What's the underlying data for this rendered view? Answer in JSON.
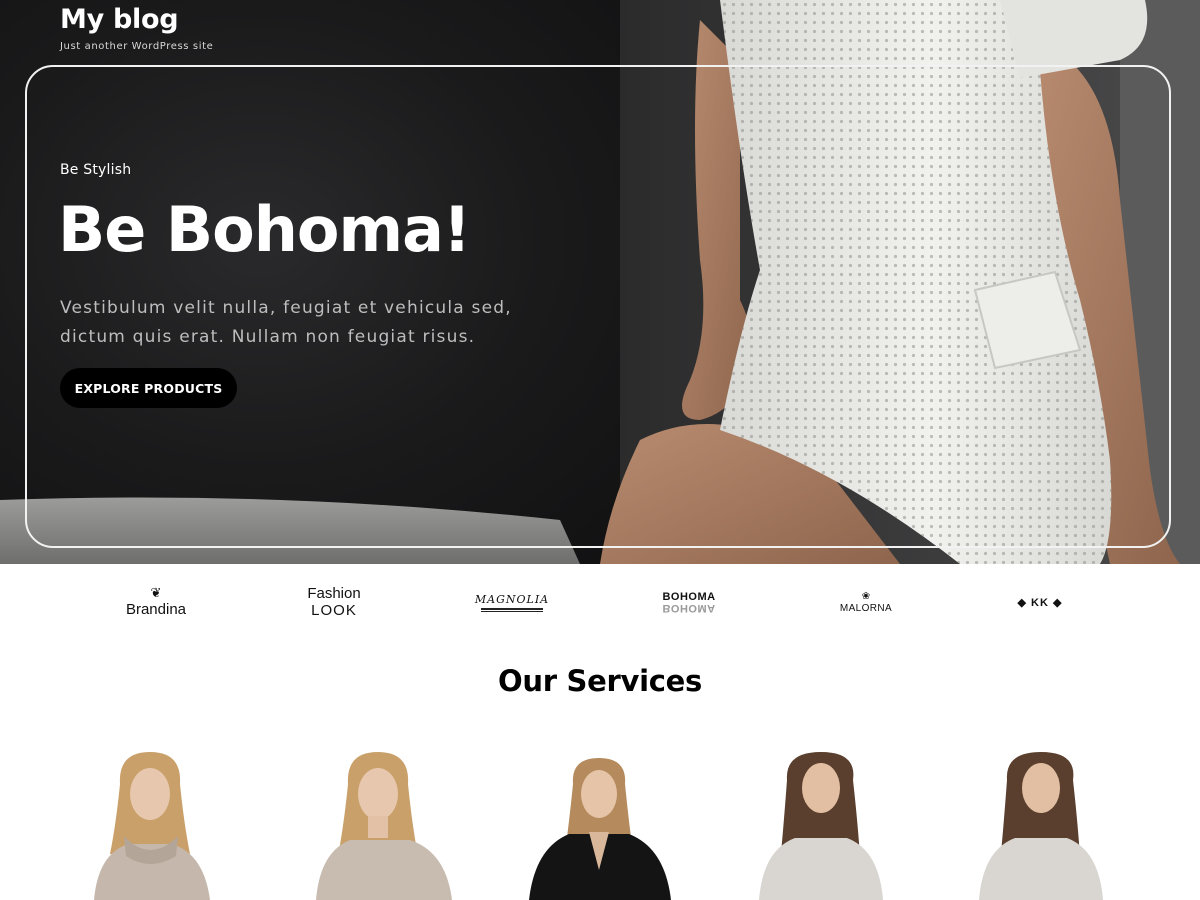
{
  "site": {
    "title": "My blog",
    "tagline": "Just another WordPress site"
  },
  "hero": {
    "kicker": "Be Stylish",
    "heading": "Be Bohoma!",
    "text": "Vestibulum velit nulla, feugiat et vehicula sed, dictum quis erat. Nullam non feugiat risus.",
    "button_label": "EXPLORE PRODUCTS",
    "image": "model-in-white-knit-dress-photo"
  },
  "brands": [
    {
      "name": "Brandina",
      "icon": "leaf-emblem-icon"
    },
    {
      "name_line1": "Fashion",
      "name_line2": "LOOK"
    },
    {
      "name": "MAGNOLIA"
    },
    {
      "name": "BOHOMA",
      "mirror": "BOHOMA"
    },
    {
      "name": "MALORNA",
      "icon": "leaf-emblem-icon"
    },
    {
      "name": "KK",
      "icon": "diamond-icon"
    }
  ],
  "services": {
    "title": "Our Services",
    "items": [
      {
        "image": "model-beige-turtleneck-photo"
      },
      {
        "image": "model-beige-off-shoulder-photo"
      },
      {
        "image": "model-black-lace-top-photo"
      },
      {
        "image": "model-grey-sweater-photo"
      },
      {
        "image": "model-grey-sweater-photo"
      }
    ]
  },
  "colors": {
    "hero_bg": "#161617",
    "button_bg": "#000000",
    "text_light": "#ffffff",
    "text_muted": "#bdbdbd",
    "page_bg": "#ffffff"
  }
}
